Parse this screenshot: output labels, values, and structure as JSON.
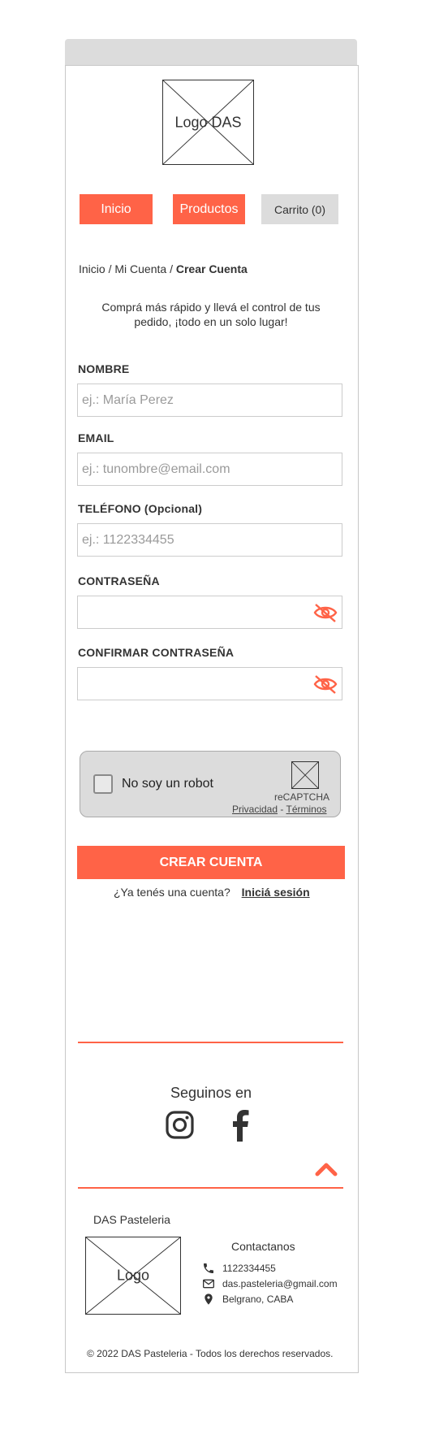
{
  "header": {
    "logo_label": "Logo DAS",
    "nav": {
      "home_label": "Inicio",
      "products_label": "Productos",
      "cart_label": "Carrito (0)"
    }
  },
  "breadcrumb": {
    "parts": [
      "Inicio",
      "/",
      "Mi Cuenta",
      "/"
    ],
    "current": "Crear Cuenta"
  },
  "intro_text": "Comprá más rápido y llevá el control de tus pedido, ¡todo en un solo lugar!",
  "form": {
    "name": {
      "label": "NOMBRE",
      "placeholder": "ej.: María Perez",
      "value": ""
    },
    "email": {
      "label": "EMAIL",
      "placeholder": "ej.: tunombre@email.com",
      "value": ""
    },
    "phone": {
      "label": "TELÉFONO (Opcional)",
      "placeholder": "ej.: 1122334455",
      "value": ""
    },
    "password": {
      "label": "CONTRASEÑA",
      "value": "",
      "icon": "eye-off-icon"
    },
    "confirm_password": {
      "label": "CONFIRMAR CONTRASEÑA",
      "value": "",
      "icon": "eye-off-icon"
    },
    "submit_label": "CREAR CUENTA"
  },
  "captcha": {
    "label": "No soy un robot",
    "brand": "reCAPTCHA",
    "privacy_label": "Privacidad",
    "separator": "-",
    "terms_label": "Términos"
  },
  "login_prompt": {
    "text": "¿Ya tenés una cuenta?",
    "link_label": "Iniciá sesión"
  },
  "footer": {
    "follow_label": "Seguinos en",
    "social": [
      "instagram-icon",
      "facebook-icon"
    ],
    "brand_name": "DAS Pasteleria",
    "logo_label": "Logo",
    "contact": {
      "title": "Contactanos",
      "phone": "1122334455",
      "email": "das.pasteleria@gmail.com",
      "address": "Belgrano, CABA"
    },
    "copyright": "© 2022 DAS Pasteleria - Todos los derechos reservados."
  },
  "colors": {
    "accent": "#ff6347",
    "neutral": "#dcdcdc",
    "text": "#333333"
  }
}
